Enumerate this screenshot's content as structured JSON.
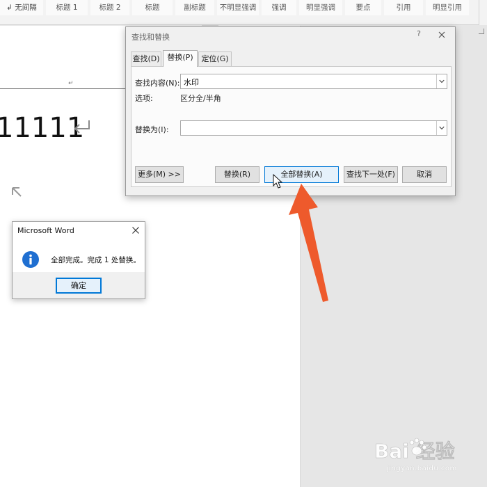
{
  "ribbon": {
    "styles": [
      {
        "label": "↲ 无间隔"
      },
      {
        "label": "标题 1"
      },
      {
        "label": "标题 2"
      },
      {
        "label": "标题"
      },
      {
        "label": "副标题"
      },
      {
        "label": "不明显强调"
      },
      {
        "label": "强调"
      },
      {
        "label": "明显强调"
      },
      {
        "label": "要点"
      },
      {
        "label": "引用"
      },
      {
        "label": "明显引用"
      }
    ]
  },
  "document": {
    "text": "11111"
  },
  "find_replace": {
    "title": "查找和替换",
    "help": "?",
    "tabs": [
      "查找(D)",
      "替换(P)",
      "定位(G)"
    ],
    "active_tab": 1,
    "find_label": "查找内容(N):",
    "find_value": "水印",
    "options_label": "选项:",
    "options_value": "区分全/半角",
    "replace_label": "替换为(I):",
    "replace_value": "",
    "buttons": {
      "more": "更多(M) >>",
      "replace": "替换(R)",
      "replace_all": "全部替换(A)",
      "find_next": "查找下一处(F)",
      "cancel": "取消"
    }
  },
  "message_box": {
    "title": "Microsoft Word",
    "message": "全部完成。完成 1 处替换。",
    "ok": "确定"
  },
  "watermark": {
    "logo_text": "Bai 经验",
    "url": "jingyan.baidu.com"
  },
  "colors": {
    "annotation_arrow": "#ee5a2c",
    "focus_blue": "#0078d7",
    "info_icon": "#1f6fd1"
  },
  "icons": {
    "dialog_close": "close-icon",
    "message_close": "close-icon",
    "message_info": "info-icon",
    "combo_arrow": "chevron-down-icon",
    "paragraph_mark": "return-arrow-icon",
    "cursor": "mouse-cursor-icon",
    "annotation": "arrow-icon"
  }
}
